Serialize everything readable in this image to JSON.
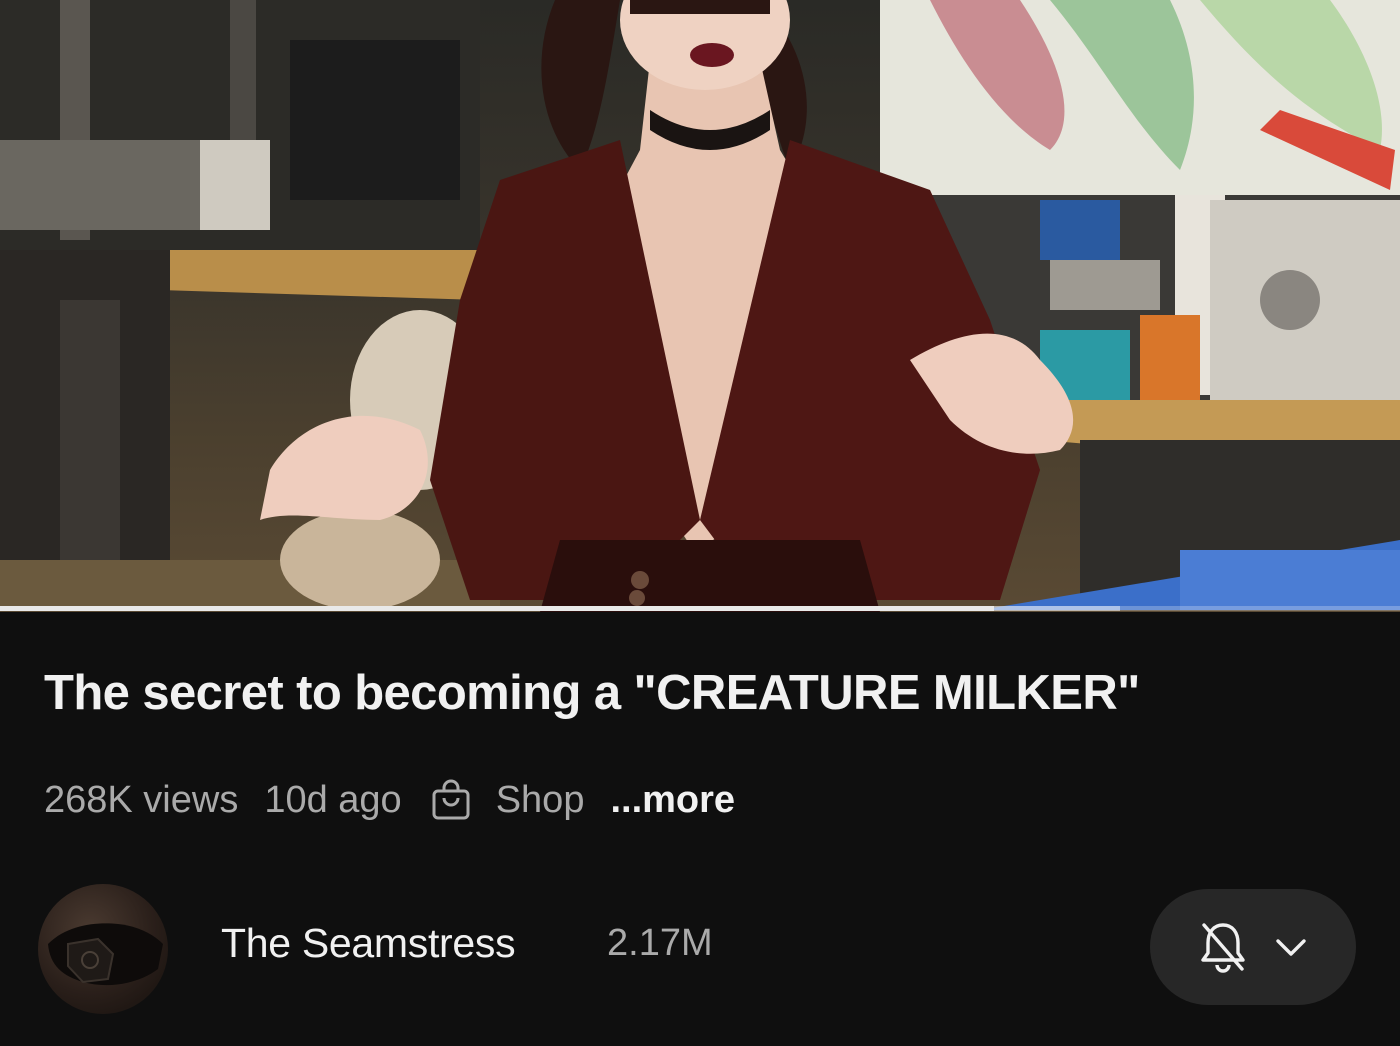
{
  "video": {
    "title": "The secret to becoming a \"CREATURE MILKER\"",
    "progress_fraction": 0.71,
    "buffered_fraction": 0.8
  },
  "meta": {
    "views": "268K views",
    "age": "10d ago",
    "shop_label": "Shop",
    "more_label": "...more",
    "shop_icon": "shopping-bag-icon"
  },
  "channel": {
    "name": "The Seamstress",
    "subscribers": "2.17M",
    "bell_icon": "bell-off-icon",
    "chevron_icon": "chevron-down-icon"
  },
  "colors": {
    "background": "#0f0f0f",
    "button": "#272727",
    "text_primary": "#f1f1f1",
    "text_secondary": "#aaaaaa"
  }
}
